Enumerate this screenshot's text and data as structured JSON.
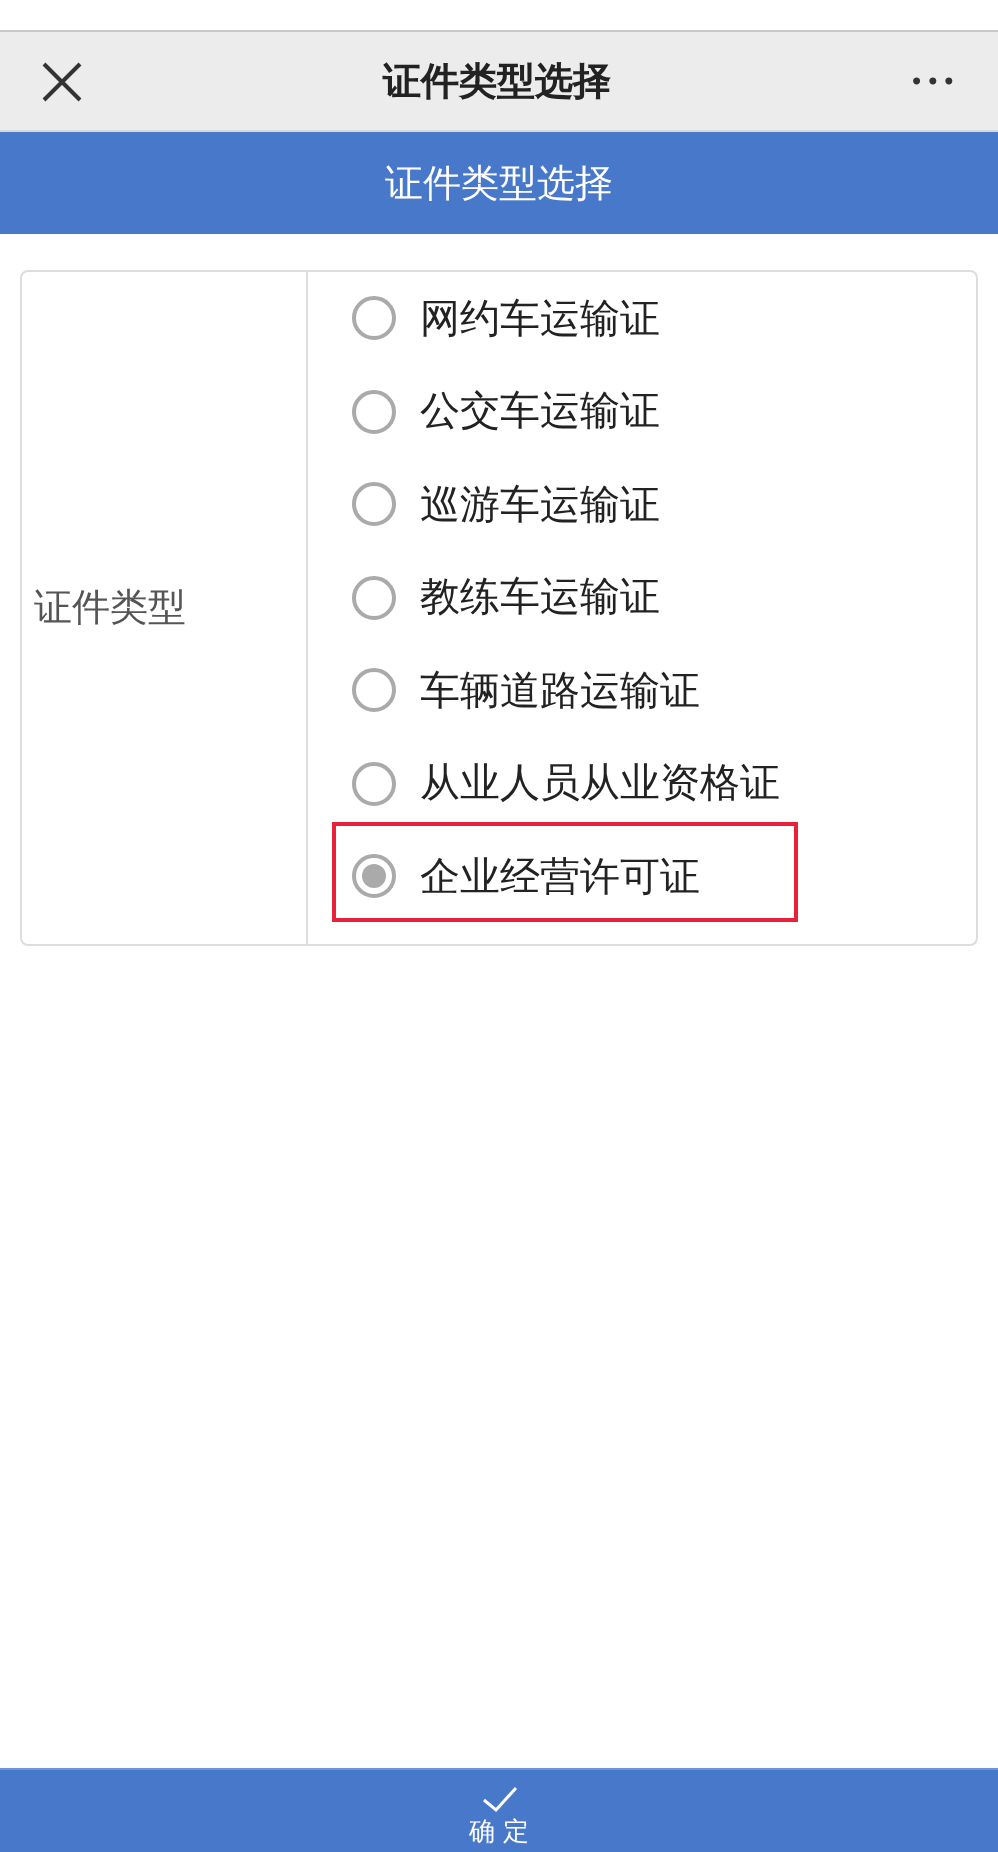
{
  "nav_bar": {
    "title": "证件类型选择",
    "more": "•••"
  },
  "header": {
    "title": "证件类型选择"
  },
  "form": {
    "label": "证件类型",
    "options": [
      {
        "label": "网约车运输证",
        "selected": false,
        "highlighted": false
      },
      {
        "label": "公交车运输证",
        "selected": false,
        "highlighted": false
      },
      {
        "label": "巡游车运输证",
        "selected": false,
        "highlighted": false
      },
      {
        "label": "教练车运输证",
        "selected": false,
        "highlighted": false
      },
      {
        "label": "车辆道路运输证",
        "selected": false,
        "highlighted": false
      },
      {
        "label": "从业人员从业资格证",
        "selected": false,
        "highlighted": false
      },
      {
        "label": "企业经营许可证",
        "selected": true,
        "highlighted": true
      }
    ]
  },
  "confirm_button": {
    "label": "确 定"
  }
}
